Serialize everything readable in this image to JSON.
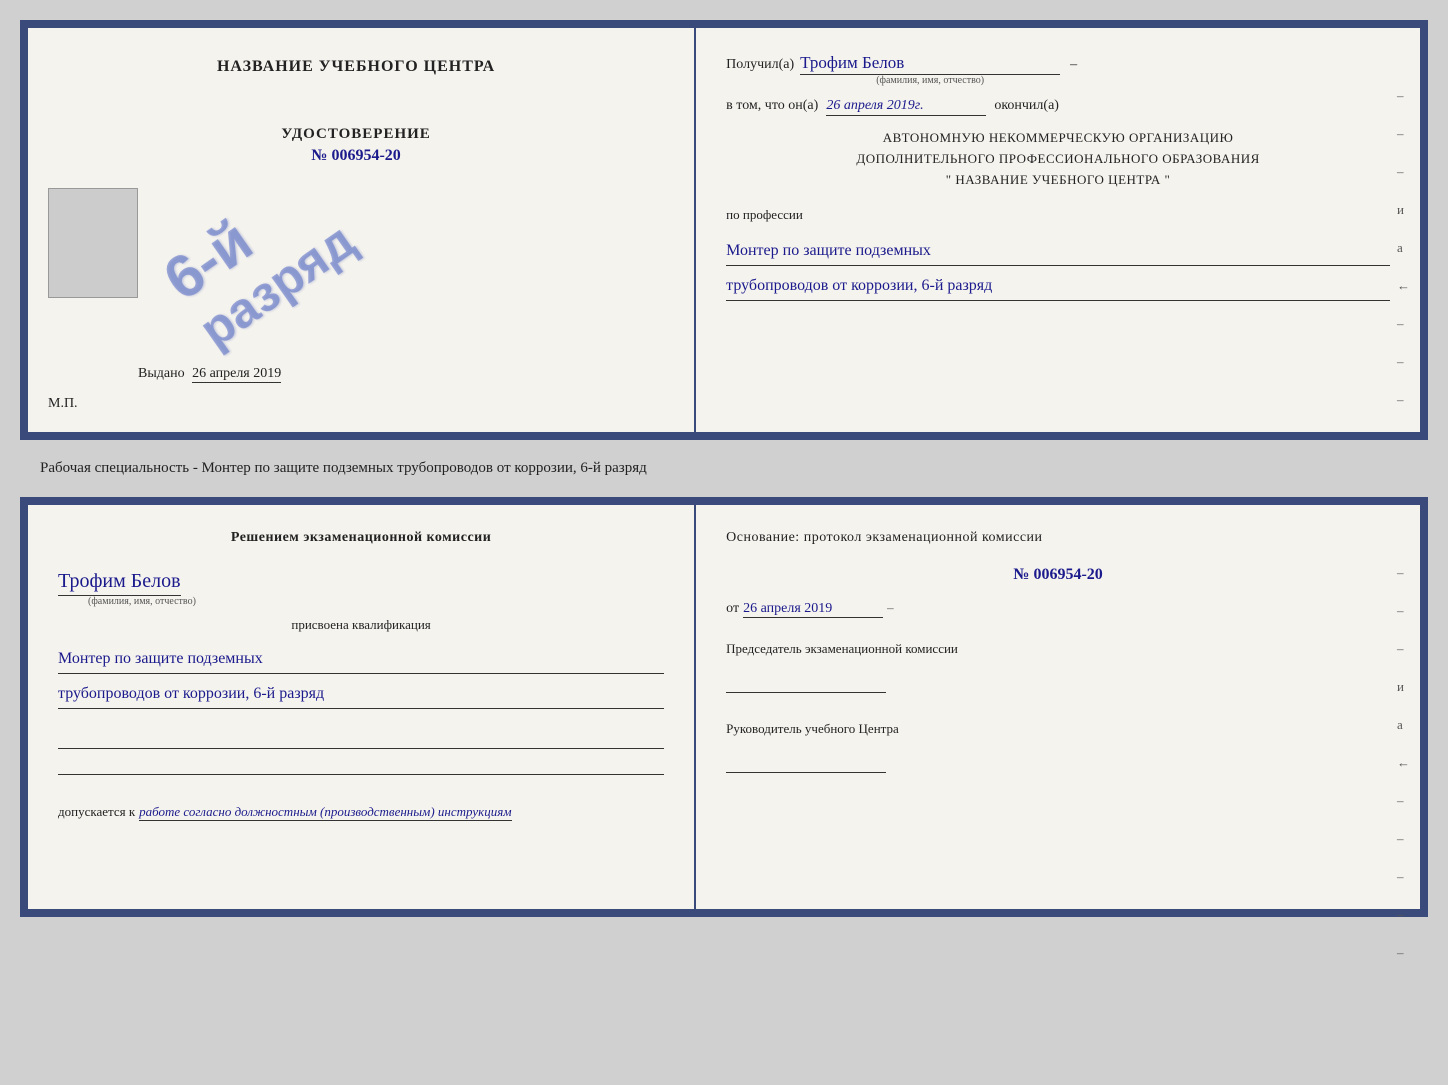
{
  "top_cert": {
    "left": {
      "training_center_label": "НАЗВАНИЕ УЧЕБНОГО ЦЕНТРА",
      "udostoverenie_label": "УДОСТОВЕРЕНИЕ",
      "cert_number": "№ 006954-20",
      "stamp_line1": "6-й",
      "stamp_line2": "разряд",
      "issued_label": "Выдано",
      "issued_date": "26 апреля 2019",
      "mp_label": "М.П."
    },
    "right": {
      "poluchil_label": "Получил(а)",
      "recipient_name": "Трофим Белов",
      "fio_sublabel": "(фамилия, имя, отчество)",
      "dash1": "–",
      "vtom_label": "в том, что он(а)",
      "date_value": "26 апреля 2019г.",
      "okoncil_label": "окончил(а)",
      "org_line1": "АВТОНОМНУЮ НЕКОММЕРЧЕСКУЮ ОРГАНИЗАЦИЮ",
      "org_line2": "ДОПОЛНИТЕЛЬНОГО ПРОФЕССИОНАЛЬНОГО ОБРАЗОВАНИЯ",
      "org_name": "\"   НАЗВАНИЕ УЧЕБНОГО ЦЕНТРА   \"",
      "professii_label": "по профессии",
      "profession_line1": "Монтер по защите подземных",
      "profession_line2": "трубопроводов от коррозии, 6-й разряд"
    }
  },
  "middle_text": {
    "content": "Рабочая специальность - Монтер по защите подземных трубопроводов от коррозии, 6-й разряд"
  },
  "bottom_cert": {
    "left": {
      "resheniem_label": "Решением  экзаменационной  комиссии",
      "full_name": "Трофим Белов",
      "fio_sublabel": "(фамилия, имя, отчество)",
      "prisvoena_label": "присвоена квалификация",
      "qualification_line1": "Монтер по защите подземных",
      "qualification_line2": "трубопроводов от коррозии, 6-й разряд",
      "dopuskaetsya_label": "допускается к",
      "dopusk_text": "работе согласно должностным (производственным) инструкциям"
    },
    "right": {
      "osnovanie_label": "Основание:  протокол  экзаменационной  комиссии",
      "protocol_number": "№  006954-20",
      "ot_label": "от",
      "ot_date": "26 апреля 2019",
      "predsedatel_label": "Председатель экзаменационной комиссии",
      "rukovoditel_label": "Руководитель учебного Центра"
    }
  },
  "side_dashes": [
    "–",
    "–",
    "–",
    "и",
    "а",
    "←",
    "–",
    "–",
    "–",
    "–",
    "–"
  ]
}
